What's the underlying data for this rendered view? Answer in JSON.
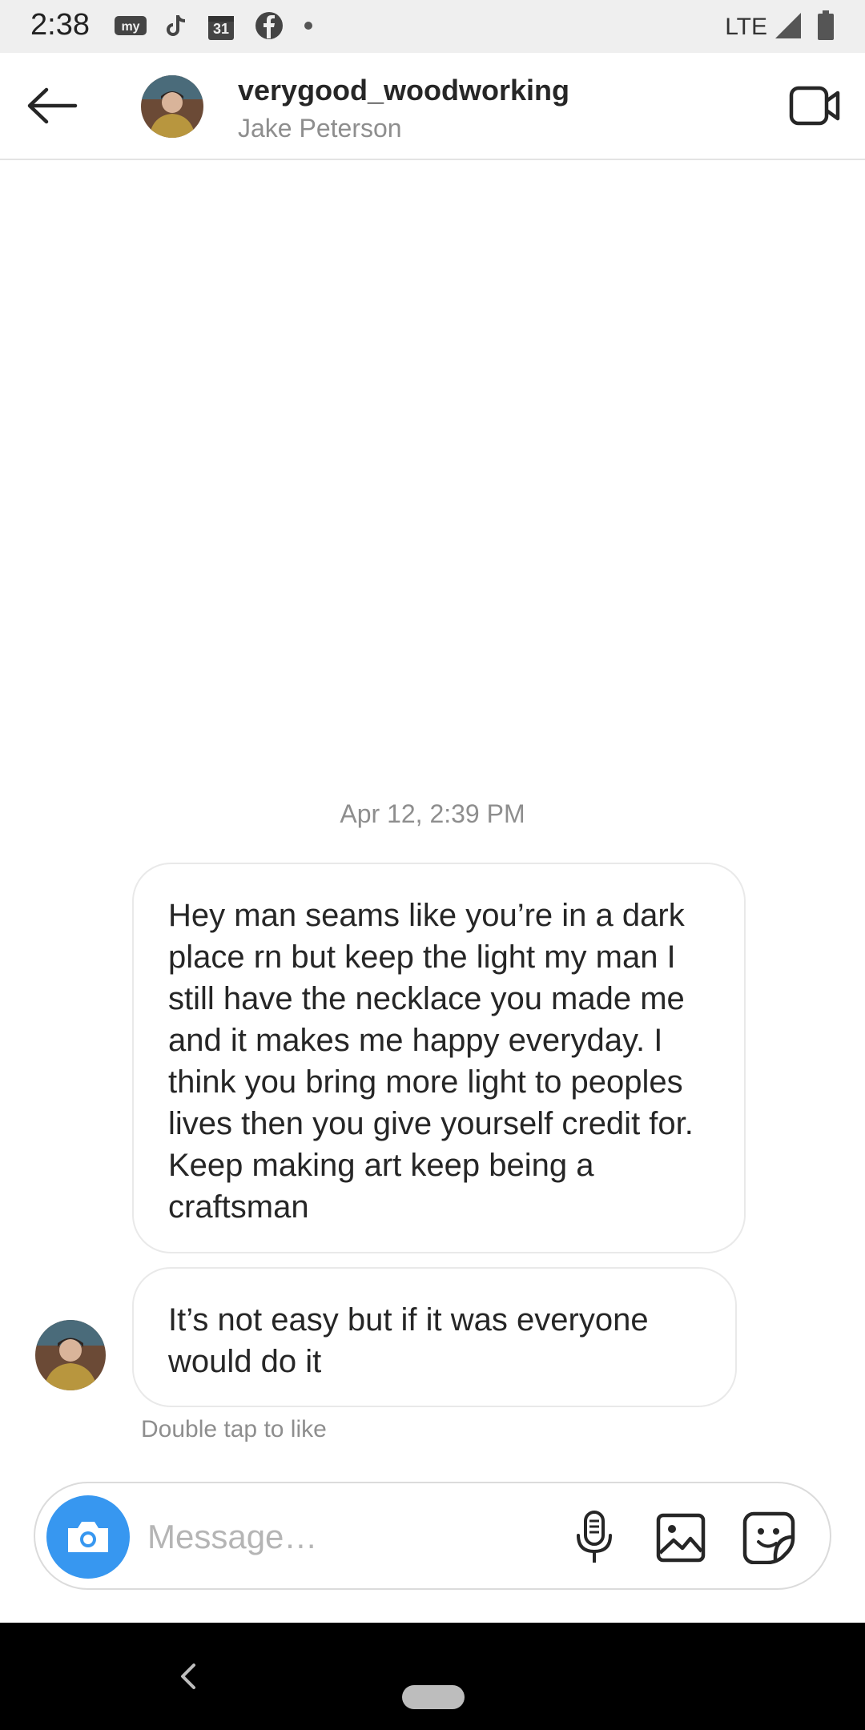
{
  "status_bar": {
    "time": "2:38",
    "calendar_day": "31",
    "network": "LTE",
    "icons": [
      "my-app-icon",
      "tiktok-icon",
      "calendar-icon",
      "facebook-icon",
      "dot-icon",
      "signal-icon",
      "battery-icon"
    ]
  },
  "header": {
    "username": "verygood_woodworking",
    "full_name": "Jake Peterson",
    "icons": [
      "back-arrow-icon",
      "avatar",
      "video-call-icon"
    ]
  },
  "chat": {
    "timestamp": "Apr 12, 2:39 PM",
    "messages": [
      {
        "text": "Hey man seams like you’re in a dark place rn but keep the light my man I still have the necklace you made me and it makes me happy everyday. I think you bring more light to peoples lives then you give yourself credit for. Keep making art keep being a craftsman"
      },
      {
        "text": "It’s not easy but if it was everyone would do it"
      }
    ],
    "hint": "Double tap to like"
  },
  "composer": {
    "placeholder": "Message…",
    "icons": [
      "camera-icon",
      "microphone-icon",
      "gallery-icon",
      "sticker-icon"
    ]
  },
  "colors": {
    "accent_blue": "#3797f0",
    "bubble_border": "#e9e9e9",
    "secondary_text": "#8e8e8e",
    "nav_bar": "#000000"
  }
}
